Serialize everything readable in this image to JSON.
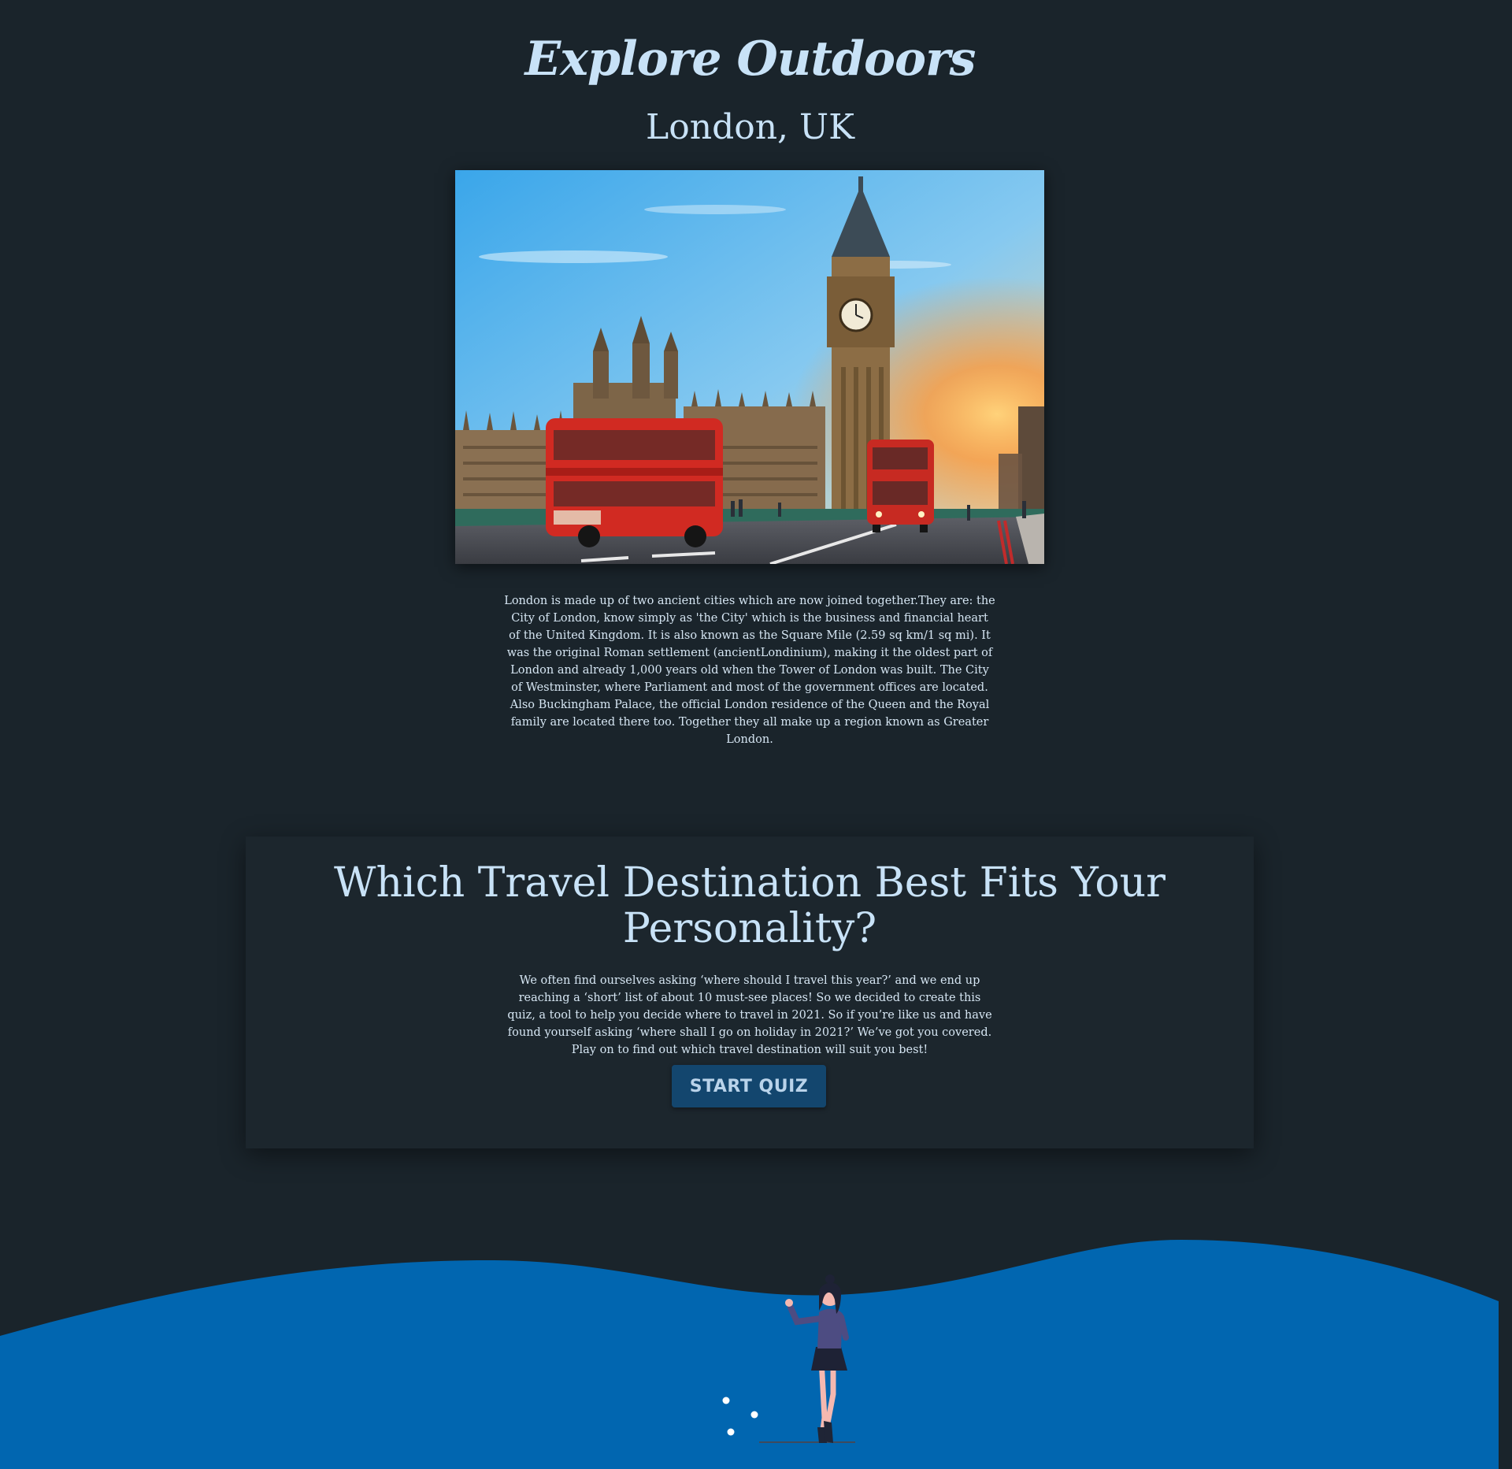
{
  "header": {
    "brand": "Explore Outdoors",
    "city": "London, UK"
  },
  "destination": {
    "description": "London is made up of two ancient cities which are now joined together.They are: the City of London, know simply as 'the City' which is the business and financial heart of the United Kingdom. It is also known as the Square Mile (2.59 sq km/1 sq mi). It was the original Roman settlement (ancientLondinium), making it the oldest part of London and already 1,000 years old when the Tower of London was built. The City of Westminster, where Parliament and most of the government offices are located. Also Buckingham Palace, the official London residence of the Queen and the Royal family are located there too. Together they all make up a region known as Greater London."
  },
  "quiz": {
    "title": "Which Travel Destination Best Fits Your Personality?",
    "intro": "We often find ourselves asking ‘where should I travel this year?’ and we end up reaching a ‘short’ list of about 10 must-see places! So we decided to create this quiz, a tool to help you decide where to travel in 2021. So if you’re like us and have found yourself asking ‘where shall I go on holiday in 2021?’ We’ve got you covered. Play on to find out which travel destination will suit you best!",
    "start_label": "START QUIZ"
  },
  "colors": {
    "background": "#1a242b",
    "card": "#1c262d",
    "heading": "#c8e2f7",
    "button": "#13466e",
    "wave": "#0166b0"
  },
  "icons": {
    "photo": "london-westminster-photo",
    "illustration": "woman-waving-illustration"
  }
}
